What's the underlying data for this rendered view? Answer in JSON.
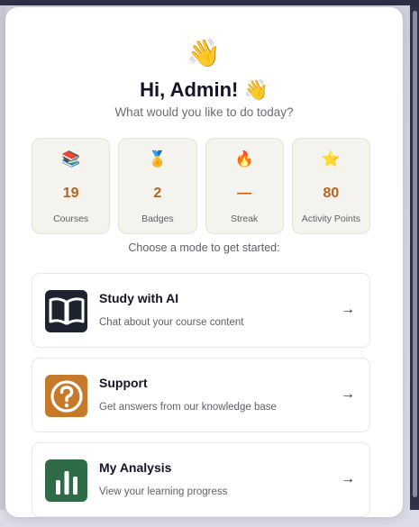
{
  "header": {
    "wave_emoji": "👋",
    "greeting": "Hi, Admin! 👋",
    "subtitle": "What would you like to do today?"
  },
  "stats": [
    {
      "emoji": "📚",
      "value": "19",
      "label": "Courses"
    },
    {
      "emoji": "🏅",
      "value": "2",
      "label": "Badges"
    },
    {
      "emoji": "🔥",
      "value": "—",
      "label": "Streak"
    },
    {
      "emoji": "⭐",
      "value": "80",
      "label": "Activity Points"
    }
  ],
  "mode_hint": "Choose a mode to get started:",
  "modes": [
    {
      "title": "Study with AI",
      "description": "Chat about your course content",
      "icon": "book-icon",
      "color": "#1e2330",
      "arrow": "→"
    },
    {
      "title": "Support",
      "description": "Get answers from our knowledge base",
      "icon": "question-icon",
      "color": "#c7792a",
      "arrow": "→"
    },
    {
      "title": "My Analysis",
      "description": "View your learning progress",
      "icon": "bar-chart-icon",
      "color": "#2f6b46",
      "arrow": "→"
    }
  ]
}
